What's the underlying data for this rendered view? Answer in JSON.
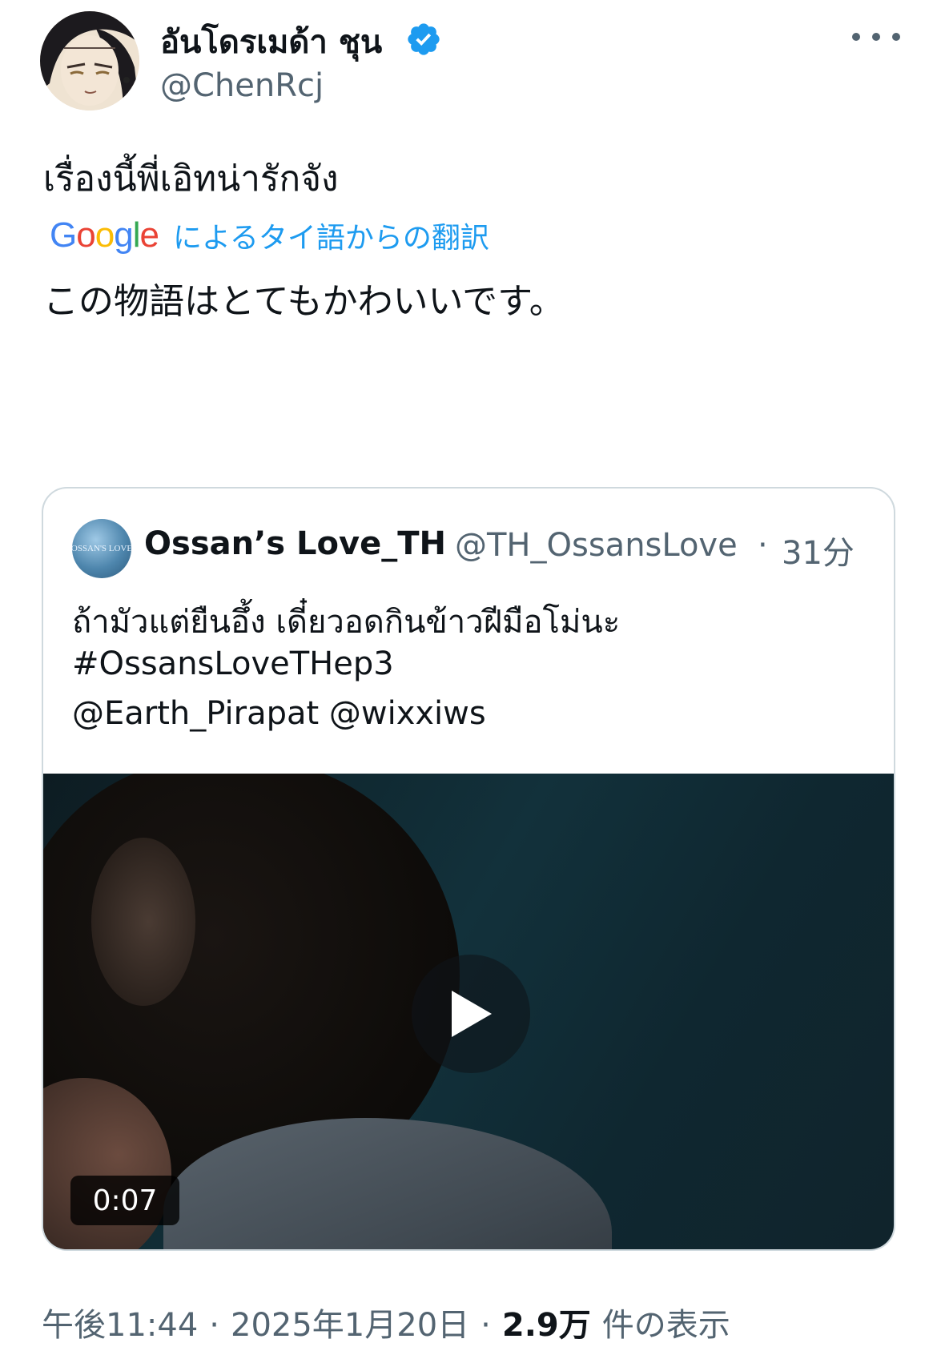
{
  "author": {
    "display_name": "อันโดรเมด้า ชุน",
    "handle": "@ChenRcj",
    "verified": true,
    "avatar_icon": "anime-avatar-icon",
    "more_icon": "more-options-icon"
  },
  "tweet": {
    "text": "เรื่องนี้พี่เอิทน่ารักจัง",
    "translation": {
      "provider": "Google",
      "label": "によるタイ語からの翻訳",
      "text": "この物語はとてもかわいいです。"
    }
  },
  "quote": {
    "avatar_text": "OSSAN'S LOVE",
    "name": "Ossan’s Love_TH",
    "handle": "@TH_OssansLove",
    "separator": "·",
    "time": "31分",
    "lines": [
      "ถ้ามัวแต่ยืนอึ้ง เดี๋ยวอดกินข้าวฝีมือโม่นะ",
      "#OssansLoveTHep3",
      "@Earth_Pirapat @wixxiws"
    ],
    "video": {
      "duration": "0:07",
      "play_icon": "play-icon"
    }
  },
  "footer": {
    "time": "午後11:44",
    "separator": "·",
    "date": "2025年1月20日",
    "views": "2.9万",
    "views_label": "件の表示"
  },
  "colors": {
    "text_primary": "#0f1419",
    "text_secondary": "#536471",
    "accent": "#1d9bf0",
    "border": "#cfd9de",
    "google_blue": "#4285F4",
    "google_red": "#EA4335",
    "google_yellow": "#FBBC05",
    "google_green": "#34A853"
  }
}
